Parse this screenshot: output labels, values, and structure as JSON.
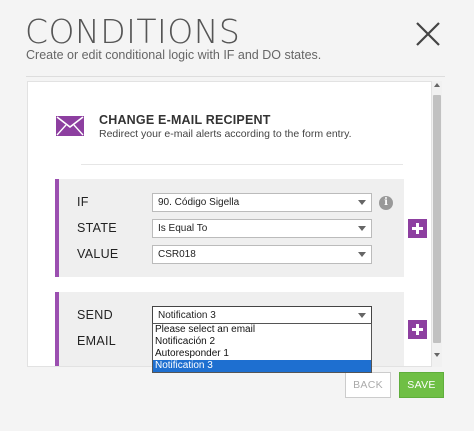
{
  "header": {
    "title": "CONDITIONS",
    "subtitle": "Create or edit conditional logic with IF and DO states."
  },
  "card": {
    "title": "CHANGE E-MAIL RECIPENT",
    "description": "Redirect your e-mail alerts according to the form entry."
  },
  "if_block": {
    "if_label": "IF",
    "if_value": "90. Código Sigella",
    "state_label": "STATE",
    "state_value": "Is Equal To",
    "value_label": "VALUE",
    "value_value": "CSR018",
    "info_glyph": "i"
  },
  "do_block": {
    "send_label": "SEND",
    "send_value": "Notification 3",
    "email_label": "EMAIL",
    "dropdown_options": [
      "Please select an email",
      "Notificación 2",
      "Autoresponder 1",
      "Notification 3"
    ],
    "selected_option": "Notification 3"
  },
  "footer": {
    "back_label": "BACK",
    "save_label": "SAVE"
  },
  "colors": {
    "accent": "#9b4fb0",
    "plus_button": "#8d3fa0",
    "save_button": "#6fbf45",
    "selected_option": "#1e6fd0"
  },
  "icons": [
    "close-icon",
    "envelope-icon",
    "info-icon",
    "plus-icon",
    "dropdown-arrow-icon",
    "scroll-arrow-icon"
  ]
}
